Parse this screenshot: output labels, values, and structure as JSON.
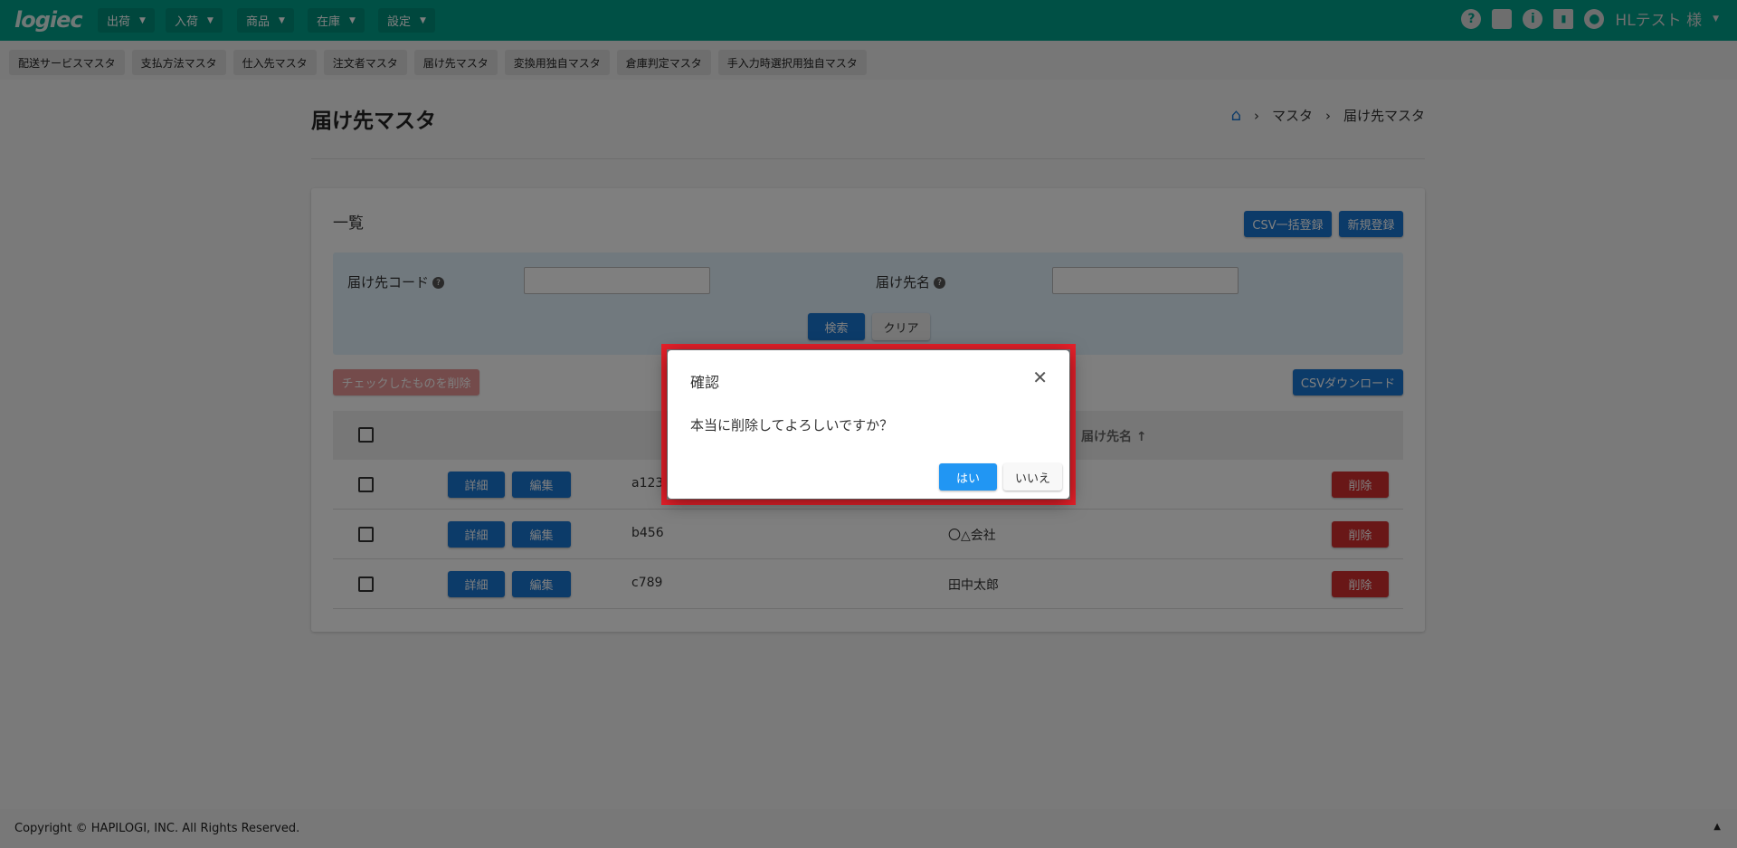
{
  "nav": {
    "logo": "logiec",
    "menus": [
      "出荷",
      "入荷",
      "商品",
      "在庫",
      "設定"
    ],
    "user": "HLテスト 様",
    "icons": [
      "help-icon",
      "briefcase-icon",
      "info-icon",
      "chart-icon",
      "account-icon"
    ]
  },
  "subnav": [
    "配送サービスマスタ",
    "支払方法マスタ",
    "仕入先マスタ",
    "注文者マスタ",
    "届け先マスタ",
    "変換用独自マスタ",
    "倉庫判定マスタ",
    "手入力時選択用独自マスタ"
  ],
  "page": {
    "title": "届け先マスタ",
    "breadcrumb": [
      "マスタ",
      "届け先マスタ"
    ]
  },
  "list": {
    "heading": "一覧",
    "csv_bulk": "CSV一括登録",
    "new": "新規登録",
    "delete_checked": "チェックしたものを削除",
    "csv_download": "CSVダウンロード"
  },
  "search": {
    "code_label": "届け先コード",
    "code_value": "",
    "name_label": "届け先名",
    "name_value": "",
    "search": "検索",
    "clear": "クリア"
  },
  "table": {
    "name_header": "届け先名",
    "sort": "↑",
    "detail": "詳細",
    "edit": "編集",
    "delete": "削除",
    "rows": [
      {
        "code": "a123",
        "name": ""
      },
      {
        "code": "b456",
        "name": "〇△会社"
      },
      {
        "code": "c789",
        "name": "田中太郎"
      }
    ]
  },
  "footer": {
    "copyright": "Copyright © HAPILOGI, INC. All Rights Reserved.",
    "top": "▲"
  },
  "modal": {
    "title": "確認",
    "message": "本当に削除してよろしいですか？",
    "yes": "はい",
    "no": "いいえ",
    "close": "✕"
  },
  "colors": {
    "nav": "#00a08a",
    "primary": "#1976d2",
    "danger": "#d32f2f",
    "modal_yes": "#2196f3",
    "highlight": "#e8202a"
  }
}
